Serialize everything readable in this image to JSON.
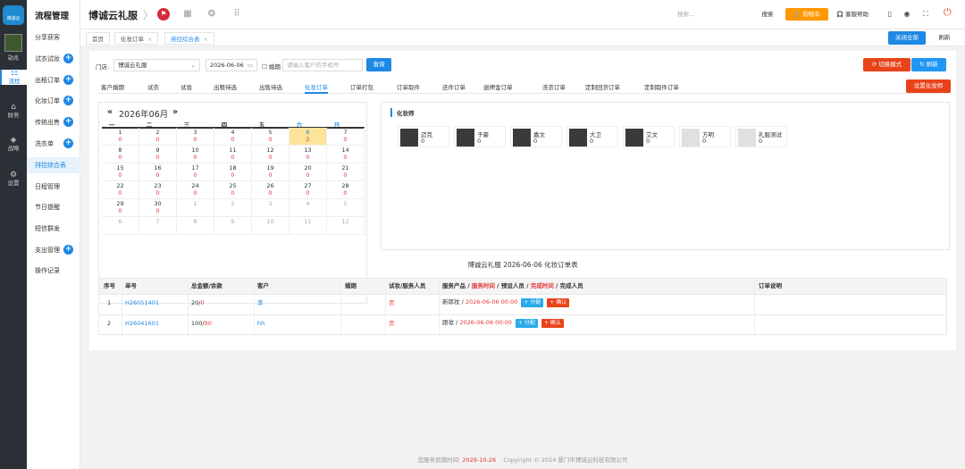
{
  "rail": {
    "logo": "博诚云",
    "user": "勋兆",
    "items": [
      {
        "icon": "☷",
        "label": "流程"
      },
      {
        "icon": "⌂",
        "label": "财务"
      },
      {
        "icon": "◈",
        "label": "战略"
      },
      {
        "icon": "⚙",
        "label": "设置"
      }
    ]
  },
  "menu": {
    "title": "流程管理",
    "items": [
      {
        "label": "分享获客",
        "plus": false
      },
      {
        "label": "试衣试妆",
        "plus": true
      },
      {
        "label": "出租订单",
        "plus": true
      },
      {
        "label": "化妆订单",
        "plus": true
      },
      {
        "label": "传统出售",
        "plus": true
      },
      {
        "label": "洗衣单",
        "plus": true
      },
      {
        "label": "排控综合表",
        "plus": false
      },
      {
        "label": "日程管理",
        "plus": false
      },
      {
        "label": "节日提醒",
        "plus": false
      },
      {
        "label": "短信群发",
        "plus": false
      },
      {
        "label": "支出管理",
        "plus": true
      },
      {
        "label": "操作记录",
        "plus": false
      }
    ]
  },
  "topbar": {
    "brand": "博诚云礼服",
    "search_placeholder": "搜索...",
    "search_btn": "搜索",
    "cart": "购物车",
    "help": "客服帮助"
  },
  "tabs": {
    "items": [
      {
        "label": "首页",
        "closable": false
      },
      {
        "label": "化妆订单",
        "closable": true
      },
      {
        "label": "排控综合表",
        "closable": true
      }
    ],
    "close_all": "关闭全部",
    "refresh": "刷新"
  },
  "filters": {
    "store_label": "门店:",
    "store_value": "博诚云礼服",
    "date_value": "2026-06-06",
    "wedding_label": "婚期",
    "phone_placeholder": "请输入客户的手机号",
    "query_btn": "查询",
    "switch_mode_btn": "切换模式",
    "refresh_btn": "刷新",
    "set_stylist_btn": "设置化妆师"
  },
  "subtabs": [
    "客户婚期",
    "试衣",
    "试妆",
    "出租待选",
    "出售待选",
    "化妆订单",
    "订单打包",
    "订单取件",
    "还件订单",
    "退押金订单",
    "洗衣订单",
    "定制回货订单",
    "定制取件订单"
  ],
  "calendar": {
    "title": "2026年06月",
    "prev": "«",
    "next": "»",
    "weekdays": [
      "一",
      "二",
      "三",
      "四",
      "五",
      "六",
      "日"
    ],
    "weeks": [
      [
        [
          "1",
          "0"
        ],
        [
          "2",
          "0"
        ],
        [
          "3",
          "0"
        ],
        [
          "4",
          "0"
        ],
        [
          "5",
          "0"
        ],
        [
          "6",
          "2"
        ],
        [
          "7",
          "0"
        ]
      ],
      [
        [
          "8",
          "0"
        ],
        [
          "9",
          "0"
        ],
        [
          "10",
          "0"
        ],
        [
          "11",
          "0"
        ],
        [
          "12",
          "0"
        ],
        [
          "13",
          "0"
        ],
        [
          "14",
          "0"
        ]
      ],
      [
        [
          "15",
          "0"
        ],
        [
          "16",
          "0"
        ],
        [
          "17",
          "0"
        ],
        [
          "18",
          "0"
        ],
        [
          "19",
          "0"
        ],
        [
          "20",
          "0"
        ],
        [
          "21",
          "0"
        ]
      ],
      [
        [
          "22",
          "0"
        ],
        [
          "23",
          "0"
        ],
        [
          "24",
          "0"
        ],
        [
          "25",
          "0"
        ],
        [
          "26",
          "0"
        ],
        [
          "27",
          "0"
        ],
        [
          "28",
          "0"
        ]
      ],
      [
        [
          "29",
          "0"
        ],
        [
          "30",
          "0"
        ],
        [
          "1",
          ""
        ],
        [
          "2",
          ""
        ],
        [
          "3",
          ""
        ],
        [
          "4",
          ""
        ],
        [
          "5",
          ""
        ]
      ],
      [
        [
          "6",
          ""
        ],
        [
          "7",
          ""
        ],
        [
          "8",
          ""
        ],
        [
          "9",
          ""
        ],
        [
          "10",
          ""
        ],
        [
          "11",
          ""
        ],
        [
          "12",
          ""
        ]
      ]
    ]
  },
  "stylists": {
    "title": "化妆师",
    "items": [
      {
        "name": "迈克",
        "count": "0",
        "photo": true
      },
      {
        "name": "子豪",
        "count": "0",
        "photo": true
      },
      {
        "name": "嘉文",
        "count": "0",
        "photo": true
      },
      {
        "name": "大卫",
        "count": "0",
        "photo": true
      },
      {
        "name": "艾文",
        "count": "0",
        "photo": true
      },
      {
        "name": "方明",
        "count": "0",
        "photo": false
      },
      {
        "name": "礼服测试",
        "count": "0",
        "photo": false
      }
    ]
  },
  "table": {
    "title": "博诚云礼服 2026-06-06 化妆订单表",
    "headers": {
      "seq": "序号",
      "order_no": "单号",
      "amount": "总金额/余款",
      "customer": "客户",
      "wedding": "婚期",
      "try_staff": "试妆/服务人员",
      "service_a": "服务产品",
      "service_b": "服务时间",
      "service_c": "预设人员",
      "service_d": "完成时间",
      "service_e": "完成人员",
      "note": "订单说明"
    },
    "rows": [
      {
        "seq": "1",
        "order_no": "H26051401",
        "total": "20",
        "balance": "0",
        "customer": "李",
        "wedding": "",
        "try": "否",
        "product": "新郎妆",
        "time": "2026-06-06 00:00",
        "assign": "+ 分配",
        "confirm": "+ 确认",
        "note": ""
      },
      {
        "seq": "2",
        "order_no": "H26041601",
        "total": "100",
        "balance": "90",
        "customer": "hh",
        "wedding": "",
        "try": "否",
        "product": "跟妆",
        "time": "2026-06-06 00:00",
        "assign": "+ 分配",
        "confirm": "+ 确认",
        "note": ""
      }
    ]
  },
  "footer": {
    "expire_label": "您服务到期时间:",
    "expire_date": "2028-10-26",
    "copyright": "Copyright © 2024 厦门市博诚云科技有限公司"
  }
}
